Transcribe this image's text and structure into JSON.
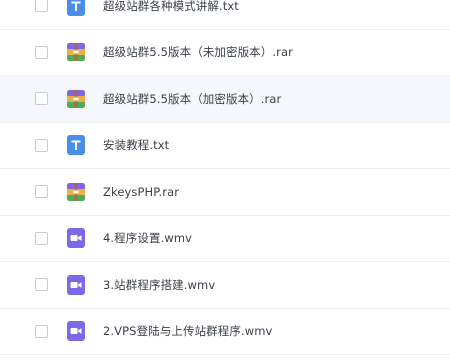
{
  "files": [
    {
      "name": "超级站群各种模式讲解.txt",
      "icon": "txt-file-icon",
      "icon_color": "#4a8ee9"
    },
    {
      "name": "超级站群5.5版本（未加密版本）.rar",
      "icon": "rar-archive-icon",
      "icon_color": "#e0723a"
    },
    {
      "name": "超级站群5.5版本（加密版本）.rar",
      "icon": "rar-archive-icon",
      "icon_color": "#e0723a"
    },
    {
      "name": "安装教程.txt",
      "icon": "txt-file-icon",
      "icon_color": "#4a8ee9"
    },
    {
      "name": "ZkeysPHP.rar",
      "icon": "rar-archive-icon",
      "icon_color": "#e0723a"
    },
    {
      "name": "4.程序设置.wmv",
      "icon": "video-file-icon",
      "icon_color": "#7a6ae8"
    },
    {
      "name": "3.站群程序搭建.wmv",
      "icon": "video-file-icon",
      "icon_color": "#7a6ae8"
    },
    {
      "name": "2.VPS登陆与上传站群程序.wmv",
      "icon": "video-file-icon",
      "icon_color": "#7a6ae8"
    }
  ],
  "hovered_row_index": 2
}
